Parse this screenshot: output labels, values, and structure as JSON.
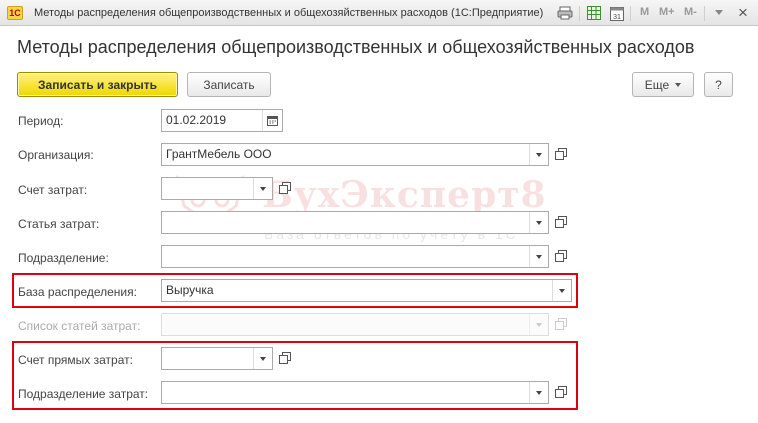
{
  "window": {
    "app_badge": "1С",
    "title": "Методы распределения общепроизводственных и общехозяйственных расходов",
    "app_name": "(1С:Предприятие)",
    "toolbar": {
      "m_label": "M",
      "m_plus_label": "M+",
      "m_minus_label": "M-",
      "calendar_day": "31"
    },
    "close_glyph": "×"
  },
  "page": {
    "title": "Методы распределения общепроизводственных и общехозяйственных расходов"
  },
  "command_bar": {
    "save_close_label": "Записать и закрыть",
    "save_label": "Записать",
    "more_label": "Еще",
    "help_label": "?"
  },
  "form": {
    "period": {
      "label": "Период:",
      "value": "01.02.2019"
    },
    "organization": {
      "label": "Организация:",
      "value": "ГрантМебель ООО"
    },
    "cost_account": {
      "label": "Счет затрат:",
      "value": ""
    },
    "cost_item": {
      "label": "Статья затрат:",
      "value": ""
    },
    "department": {
      "label": "Подразделение:",
      "value": ""
    },
    "distribution_base": {
      "label": "База распределения:",
      "value": "Выручка"
    },
    "cost_items_list": {
      "label": "Список статей затрат:",
      "value": ""
    },
    "direct_cost_account": {
      "label": "Счет прямых затрат:",
      "value": ""
    },
    "cost_department": {
      "label": "Подразделение затрат:",
      "value": ""
    }
  },
  "watermark": {
    "title": "БухЭксперт8",
    "subtitle": "База ответов по учёту в 1С"
  },
  "colors": {
    "highlight": "#e0000f",
    "primary_button": "#f5de00",
    "watermark": "#d73c3c"
  }
}
